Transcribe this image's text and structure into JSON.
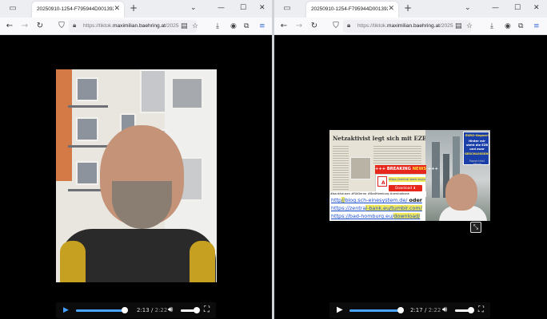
{
  "windows": [
    {
      "tab_title": "20250910-1254-F795944D0013923...",
      "url_prefix": "https://tiktok.",
      "url_domain": "maximilian.baehring.at",
      "url_suffix": "/2025",
      "video": {
        "elapsed": "2:13",
        "duration": "2:22",
        "time_separator": "/",
        "progress": 0.937,
        "volume": 1.0
      }
    },
    {
      "tab_title": "20250910-1254-F795944D0013923...",
      "url_prefix": "https://tiktok.",
      "url_domain": "maximilian.baehring.at",
      "url_suffix": "/2025",
      "video": {
        "elapsed": "2:17",
        "duration": "2:22",
        "time_separator": "/",
        "progress": 0.965,
        "volume": 1.0
      },
      "overlay": {
        "headline": "Netzaktivist legt sich mit EZB an",
        "breaking_prefix": "+++ BREAKING",
        "breaking_news": "NEWS",
        "breaking_suffix": "+++",
        "panel_url": "https://zentral-bank.eu/pdf",
        "download_label": "Download",
        "euro_lines": [
          "EURO-Gegner!",
          "Hinter mir",
          "steht die EZB",
          "und zwar",
          "GESCHLOSSEN!",
          "Tweet this! #fbde"
        ],
        "hashtags": "#bankhausen #FAKterror #BadHomburg #zentralbank",
        "link1_pre": "http",
        "link1_hl": "//",
        "link1_post": "blog.sch-einesystem.de/",
        "link1_tail": "oder",
        "link2_pre": "https://zentra",
        "link2_hl": "l-bank.eu/tumblr.com/",
        "link3_pre": "https://bad-homburg.eu/",
        "link3_hl": "download/"
      }
    }
  ],
  "icons": {
    "tab_overview": "tab-overview-icon",
    "back": "back-arrow-icon",
    "forward": "forward-arrow-icon",
    "reload": "reload-icon",
    "shield": "tracking-shield-icon",
    "lock": "lock-icon",
    "reader": "reader-view-icon",
    "bookmark": "star-icon",
    "download": "download-icon",
    "account": "account-icon",
    "extensions": "extensions-icon",
    "menu": "hamburger-menu-icon",
    "play": "play-icon",
    "volume": "volume-icon",
    "fullscreen": "fullscreen-icon",
    "pip": "picture-in-picture-icon"
  },
  "colors": {
    "progress": "#4aa7ff",
    "breaking": "#e7261c",
    "highlight": "#f3ea59",
    "link": "#1a4dd1"
  }
}
